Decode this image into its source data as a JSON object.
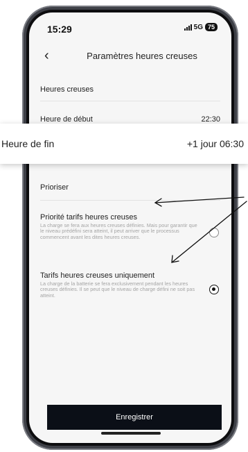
{
  "status": {
    "time": "15:29",
    "network": "5G",
    "battery": "75"
  },
  "header": {
    "title": "Paramètres heures creuses"
  },
  "settings": {
    "off_peak_label": "Heures creuses",
    "start": {
      "label": "Heure de début",
      "value": "22:30"
    },
    "end": {
      "label": "Heure de fin",
      "value": "+1 jour 06:30"
    },
    "prioritize_label": "Prioriser"
  },
  "options": [
    {
      "title": "Priorité tarifs heures creuses",
      "description": "La charge se fera aux heures creuses définies. Mais pour garantir que le niveau prédéfini sera atteint, il peut arriver que le processus commencent avant les dites heures creuses.",
      "selected": false
    },
    {
      "title": "Tarifs heures creuses uniquement",
      "description": "La charge de la batterie se fera exclusivement pendant les heures creuses définies. Il se peut que le niveau de charge défini ne soit pas atteint.",
      "selected": true
    }
  ],
  "footer": {
    "save_label": "Enregistrer"
  },
  "colors": {
    "accent": "#0b0f17",
    "background": "#f6f6f6",
    "muted_text": "#a4a4a4"
  }
}
